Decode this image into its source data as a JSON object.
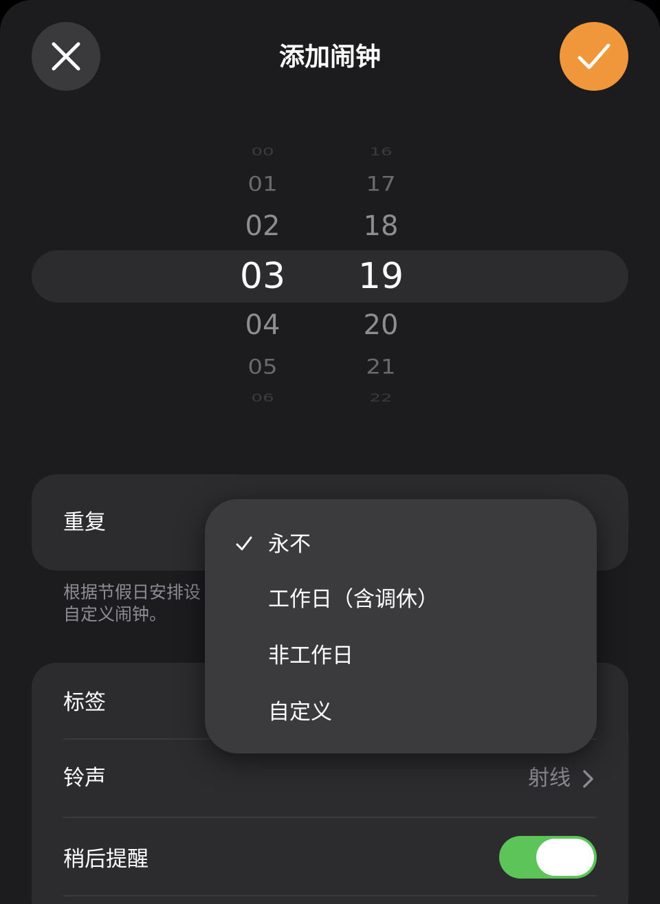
{
  "header": {
    "title": "添加闹钟",
    "close_icon": "close-icon",
    "confirm_icon": "checkmark-icon",
    "accent_color": "#f0973c"
  },
  "time_picker": {
    "hours": [
      "00",
      "01",
      "02",
      "03",
      "04",
      "05",
      "06"
    ],
    "minutes": [
      "16",
      "17",
      "18",
      "19",
      "20",
      "21",
      "22"
    ],
    "selected_hour": "03",
    "selected_minute": "19"
  },
  "repeat": {
    "label": "重复",
    "note_line1": "根据节假日安排设",
    "note_line2": "自定义闹钟。"
  },
  "repeat_menu": {
    "items": [
      {
        "label": "永不",
        "checked": true
      },
      {
        "label": "工作日（含调休）",
        "checked": false
      },
      {
        "label": "非工作日",
        "checked": false
      },
      {
        "label": "自定义",
        "checked": false
      }
    ]
  },
  "settings": {
    "tag_label": "标签",
    "ringtone_label": "铃声",
    "ringtone_value": "射线",
    "snooze_label": "稍后提醒",
    "snooze_on": true,
    "toggle_color": "#5dc45a"
  }
}
